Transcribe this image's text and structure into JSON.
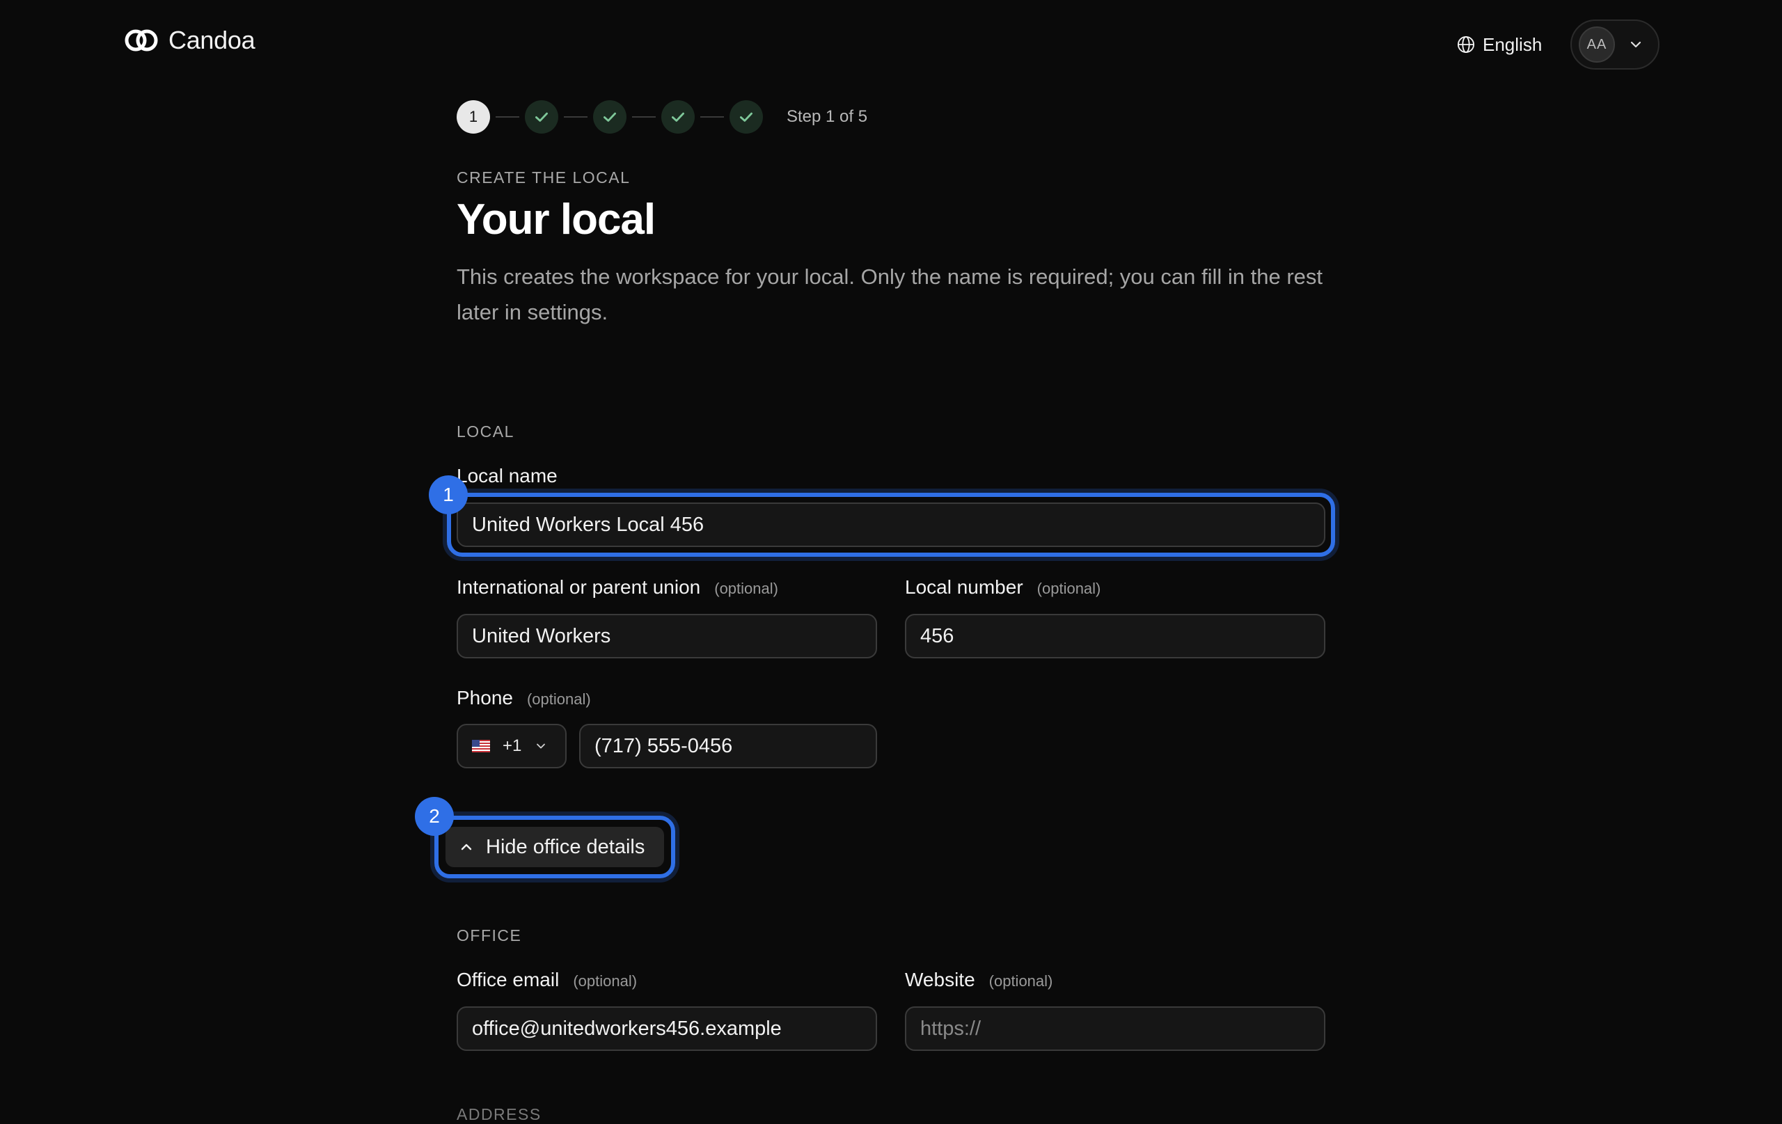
{
  "header": {
    "brand_name": "Candoa",
    "language_label": "English",
    "avatar_initials": "AA"
  },
  "stepper": {
    "current_step": "1",
    "step_count_label": "Step 1 of 5",
    "total_steps": 5,
    "completed_steps": 4
  },
  "page": {
    "eyebrow": "CREATE THE LOCAL",
    "title": "Your local",
    "description": "This creates the workspace for your local. Only the name is required; you can fill in the rest later in settings."
  },
  "local_section": {
    "label": "LOCAL",
    "local_name": {
      "label": "Local name",
      "value": "United Workers Local 456",
      "badge": "1"
    },
    "parent_union": {
      "label": "International or parent union",
      "optional": "(optional)",
      "value": "United Workers"
    },
    "local_number": {
      "label": "Local number",
      "optional": "(optional)",
      "value": "456"
    },
    "phone": {
      "label": "Phone",
      "optional": "(optional)",
      "country_code": "+1",
      "country_flag_icon": "us-flag-icon",
      "value": "(717) 555-0456"
    }
  },
  "office_toggle": {
    "label": "Hide office details",
    "badge": "2"
  },
  "office_section": {
    "label": "OFFICE",
    "office_email": {
      "label": "Office email",
      "optional": "(optional)",
      "value": "office@unitedworkers456.example"
    },
    "website": {
      "label": "Website",
      "optional": "(optional)",
      "value": "",
      "placeholder": "https://"
    }
  },
  "address_section": {
    "label": "ADDRESS"
  },
  "colors": {
    "background": "#0a0a0a",
    "accent_highlight": "#2f6fe6",
    "step_done_bg": "#1b2b21",
    "check": "#7fc89a"
  }
}
